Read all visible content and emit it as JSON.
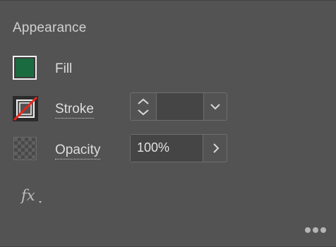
{
  "appearance": {
    "title": "Appearance",
    "fill": {
      "label": "Fill",
      "color": "#1b6b41"
    },
    "stroke": {
      "label": "Stroke",
      "swatch_state": "none",
      "weight_value": "",
      "up_icon": "chevron-up-icon",
      "down_icon": "chevron-down-icon",
      "dropdown_icon": "chevron-down-icon"
    },
    "opacity": {
      "label": "Opacity",
      "value": "100%",
      "arrow_icon": "chevron-right-icon"
    },
    "effects_icon": "fx-icon",
    "more_icon": "more-horizontal-icon"
  },
  "colors": {
    "panel_bg": "#535353",
    "field_bg": "#454545",
    "border": "#6e6e6e",
    "text": "#dddddd",
    "none_slash": "#e8261c"
  }
}
